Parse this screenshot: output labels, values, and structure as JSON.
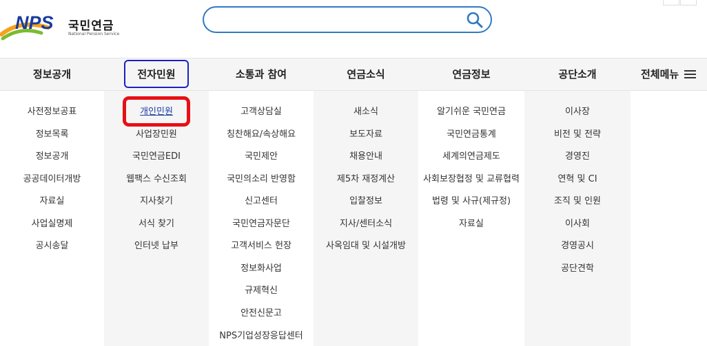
{
  "logo": {
    "mark_text": "NPS",
    "ko_text": "국민연금",
    "en_text": "National Pension Service"
  },
  "search": {
    "value": "",
    "placeholder": ""
  },
  "nav": {
    "items": [
      {
        "label": "정보공개"
      },
      {
        "label": "전자민원"
      },
      {
        "label": "소통과 참여"
      },
      {
        "label": "연금소식"
      },
      {
        "label": "연금정보"
      },
      {
        "label": "공단소개"
      }
    ],
    "all_menu_label": "전체메뉴"
  },
  "submenus": [
    [
      "사전정보공표",
      "정보목록",
      "정보공개",
      "공공데이터개방",
      "자료실",
      "사업실명제",
      "공시송달"
    ],
    [
      "개인민원",
      "사업장민원",
      "국민연금EDI",
      "웹팩스 수신조회",
      "지사찾기",
      "서식 찾기",
      "인터넷 납부"
    ],
    [
      "고객상담실",
      "칭찬해요/속상해요",
      "국민제안",
      "국민의소리 반영함",
      "신고센터",
      "국민연금자문단",
      "고객서비스 헌장",
      "정보화사업",
      "규제혁신",
      "안전신문고",
      "NPS기업성장응답센터"
    ],
    [
      "새소식",
      "보도자료",
      "채용안내",
      "제5차 재정계산",
      "입찰정보",
      "지사/센터소식",
      "사옥임대 및 시설개방"
    ],
    [
      "알기쉬운 국민연금",
      "국민연금통계",
      "세계의연금제도",
      "사회보장협정 및 교류협력",
      "법령 및 사규(제규정)",
      "자료실"
    ],
    [
      "이사장",
      "비전 및 전략",
      "경영진",
      "연혁 및 CI",
      "조직 및 인원",
      "이사회",
      "경영공시",
      "공단견학"
    ]
  ],
  "colors": {
    "brand_blue": "#1a3c9c",
    "brand_orange": "#f4a11d",
    "brand_green": "#7dbb2f",
    "search_border": "#2f78c4",
    "nav_highlight": "#1b1fc4",
    "active_box": "#e80f14"
  }
}
